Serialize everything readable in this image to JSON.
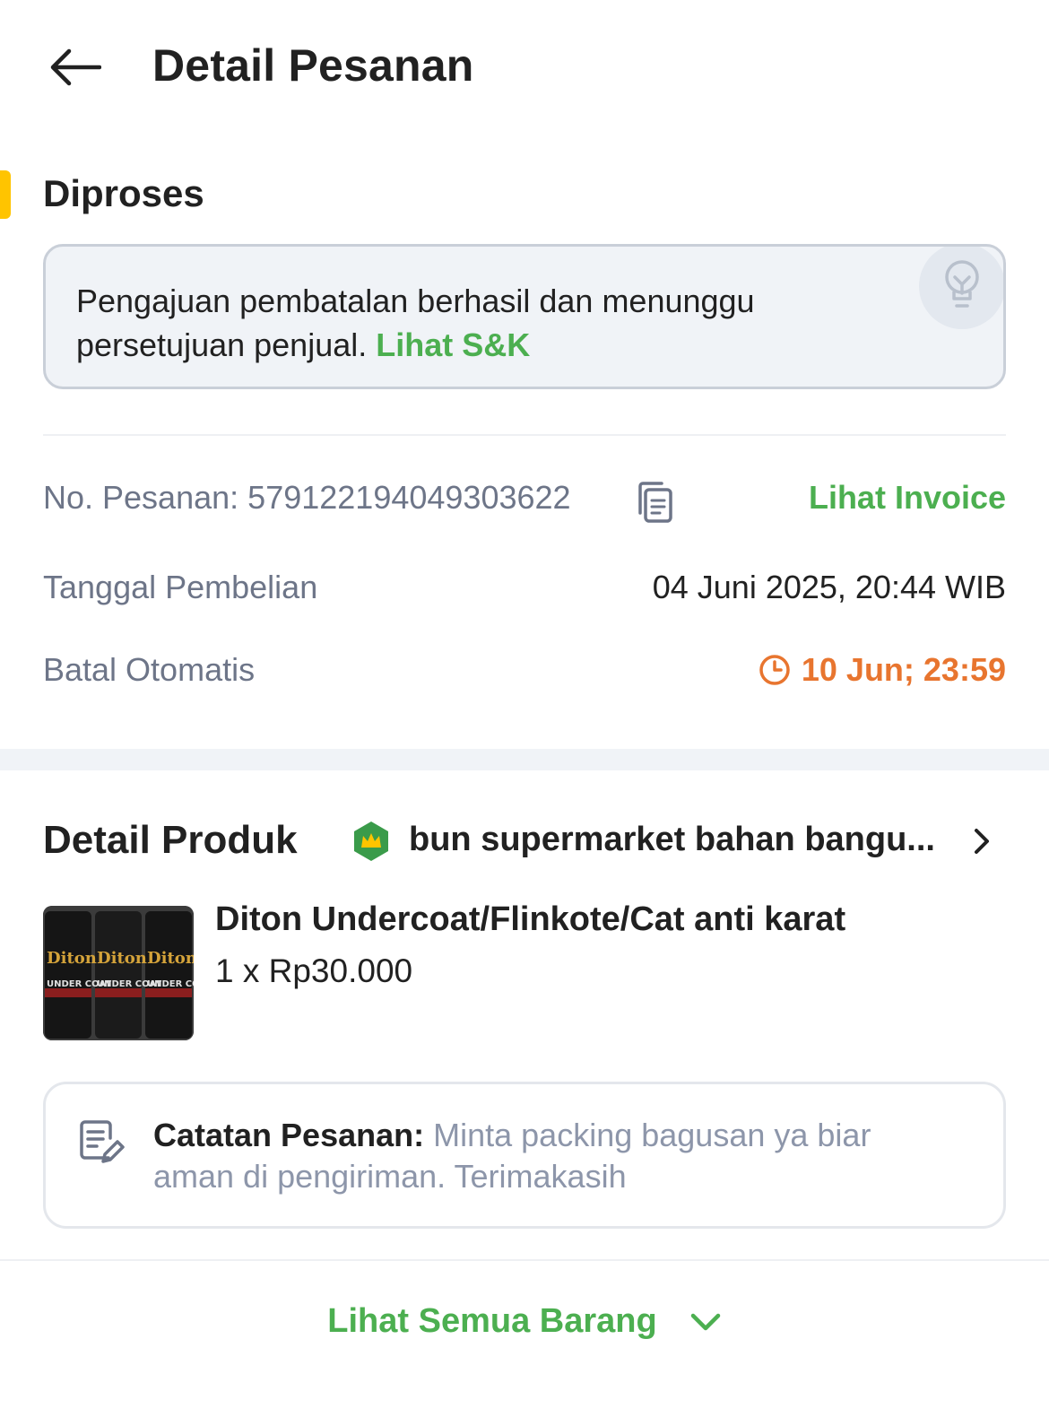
{
  "header": {
    "back_icon": "arrow-left-icon",
    "title": "Detail Pesanan"
  },
  "status": {
    "title": "Diproses",
    "accent_color": "#FFC400",
    "info_message": "Pengajuan pembatalan berhasil dan menunggu persetujuan penjual.",
    "info_link": "Lihat S&K",
    "info_icon": "lightbulb-icon"
  },
  "order": {
    "number_label": "No. Pesanan:",
    "number_value": "579122194049303622",
    "copy_icon": "copy-icon",
    "invoice_link": "Lihat Invoice",
    "date_label": "Tanggal Pembelian",
    "date_value": "04 Juni 2025, 20:44 WIB",
    "auto_cancel_label": "Batal Otomatis",
    "auto_cancel_value": "10 Jun; 23:59",
    "auto_cancel_color": "#E8752F"
  },
  "product_section": {
    "title": "Detail Produk",
    "shop_badge_icon": "official-store-badge-icon",
    "shop_name": "bun supermarket bahan bangu...",
    "shop_chevron_icon": "chevron-right-icon",
    "product": {
      "name": "Diton Undercoat/Flinkote/Cat anti karat",
      "price": "1 x Rp30.000",
      "image_label_brand": "Diton",
      "image_label_type": "UNDER COAT"
    },
    "note": {
      "label": "Catatan Pesanan:",
      "text": "Minta packing bagusan ya biar aman di pengiriman. Terimakasih",
      "icon": "note-edit-icon"
    }
  },
  "footer": {
    "see_all_label": "Lihat Semua Barang",
    "see_all_icon": "chevron-down-icon",
    "accent_color": "#4CAF50"
  }
}
